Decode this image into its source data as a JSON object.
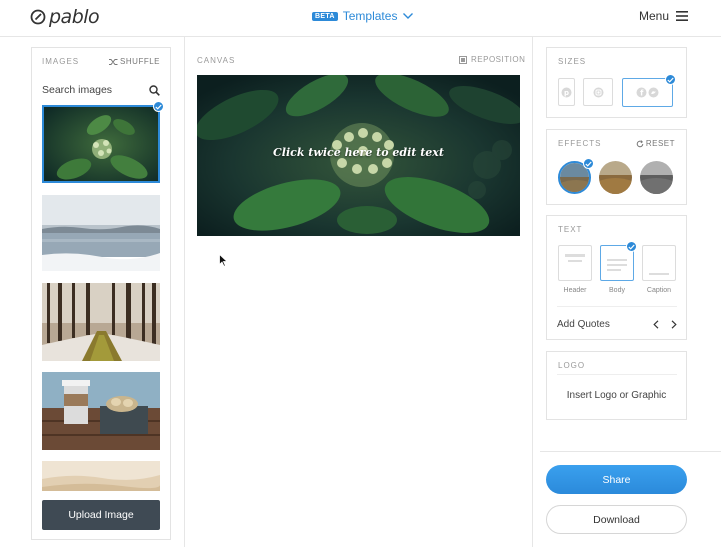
{
  "header": {
    "logo_text": "pablo",
    "beta_badge": "BETA",
    "templates_label": "Templates",
    "menu_label": "Menu"
  },
  "images_panel": {
    "title": "IMAGES",
    "shuffle_label": "SHUFFLE",
    "search_placeholder": "Search images",
    "upload_label": "Upload Image",
    "thumbnails": [
      "green-leaf-plant",
      "frozen-lake",
      "forest-trail",
      "coffee-cup-box",
      "sandy-landscape"
    ],
    "selected_index": 0
  },
  "canvas": {
    "title": "CANVAS",
    "reposition_label": "REPOSITION",
    "overlay_text": "Click twice here to edit text"
  },
  "sizes": {
    "title": "SIZES",
    "options": [
      "pinterest",
      "instagram",
      "facebook-twitter"
    ],
    "selected": "facebook-twitter"
  },
  "effects": {
    "title": "EFFECTS",
    "reset_label": "RESET",
    "options": [
      "original",
      "warm",
      "grayscale"
    ],
    "selected": "original"
  },
  "text": {
    "title": "TEXT",
    "options": [
      {
        "label": "Header"
      },
      {
        "label": "Body"
      },
      {
        "label": "Caption"
      }
    ],
    "selected": "Body",
    "quotes_label": "Add Quotes"
  },
  "logo": {
    "title": "LOGO",
    "insert_label": "Insert Logo or Graphic"
  },
  "actions": {
    "share_label": "Share",
    "download_label": "Download"
  },
  "colors": {
    "accent": "#2d8ad8",
    "upload_bg": "#3f4a54",
    "share_bg": "#3aa0ee"
  }
}
